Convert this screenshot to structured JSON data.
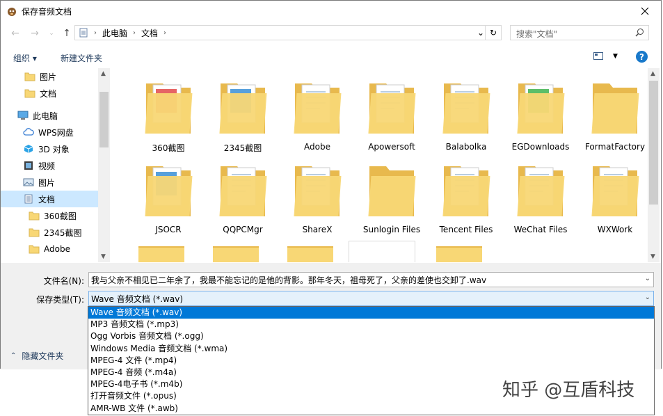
{
  "window": {
    "title": "保存音频文档"
  },
  "address": {
    "crumbs": [
      "此电脑",
      "文档"
    ],
    "search_placeholder": "搜索\"文档\""
  },
  "toolbar": {
    "organize": "组织 ▾",
    "new_folder": "新建文件夹",
    "help": "?"
  },
  "sidebar": {
    "items": [
      {
        "label": "图片",
        "icon": "folder-icon"
      },
      {
        "label": "文档",
        "icon": "folder-icon"
      },
      {
        "label": "此电脑",
        "icon": "computer-icon"
      },
      {
        "label": "WPS网盘",
        "icon": "cloud-icon"
      },
      {
        "label": "3D 对象",
        "icon": "cube-icon"
      },
      {
        "label": "视频",
        "icon": "video-icon"
      },
      {
        "label": "图片",
        "icon": "picture-icon"
      },
      {
        "label": "文档",
        "icon": "document-icon"
      },
      {
        "label": "360截图",
        "icon": "folder-icon"
      },
      {
        "label": "2345截图",
        "icon": "folder-icon"
      },
      {
        "label": "Adobe",
        "icon": "folder-icon"
      }
    ]
  },
  "folders": [
    "360截图",
    "2345截图",
    "Adobe",
    "Apowersoft",
    "Balabolka",
    "EGDownloads",
    "FormatFactory",
    "JSOCR",
    "QQPCMgr",
    "ShareX",
    "Sunlogin Files",
    "Tencent Files",
    "WeChat Files",
    "WXWork"
  ],
  "bottom": {
    "filename_label": "文件名(N):",
    "filename_value": "我与父亲不相见已二年余了，我最不能忘记的是他的背影。那年冬天，祖母死了，父亲的差使也交卸了.wav",
    "filetype_label": "保存类型(T):",
    "filetype_value": "Wave 音频文档 (*.wav)",
    "hide_folders": "隐藏文件夹"
  },
  "dropdown": {
    "options": [
      "Wave 音频文档 (*.wav)",
      "MP3 音频文档 (*.mp3)",
      "Ogg Vorbis 音频文档 (*.ogg)",
      "Windows Media 音频文档 (*.wma)",
      "MPEG-4 文件 (*.mp4)",
      "MPEG-4 音频 (*.m4a)",
      "MPEG-4电子书 (*.m4b)",
      "打开音频文件 (*.opus)",
      "AMR-WB 文件 (*.awb)"
    ]
  },
  "watermark": "知乎 @互盾科技",
  "colors": {
    "accent": "#0078d7",
    "selection": "#cce8ff",
    "folder": "#f8d775"
  }
}
